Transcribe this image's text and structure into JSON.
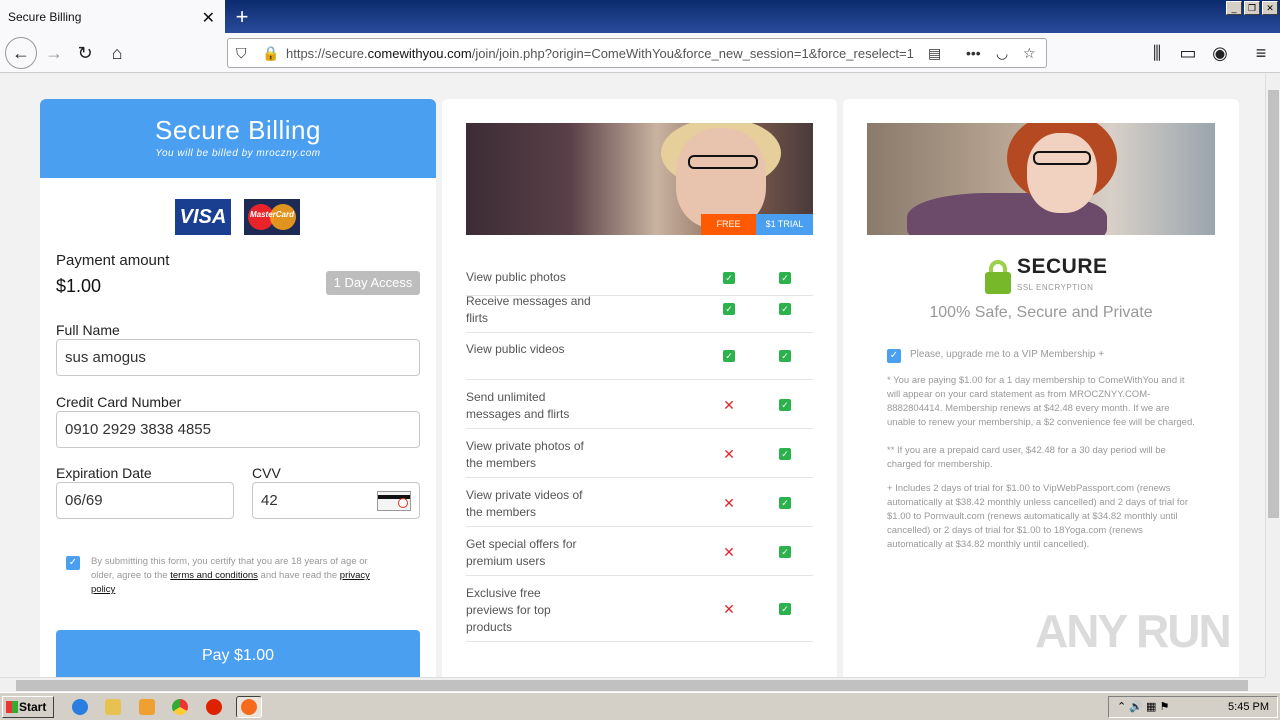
{
  "browser": {
    "tab_title": "Secure Billing",
    "url_prefix": "https://secure.",
    "url_domain": "comewithyou.com",
    "url_rest": "/join/join.php?origin=ComeWithYou&force_new_session=1&force_reselect=1"
  },
  "billing": {
    "title": "Secure Billing",
    "subtitle": "You will be billed by mroczny.com",
    "visa": "VISA",
    "mastercard": "MasterCard",
    "payment_label": "Payment amount",
    "amount": "$1.00",
    "access": "1 Day Access",
    "full_name_label": "Full Name",
    "full_name": "sus amogus",
    "cc_label": "Credit Card Number",
    "cc": "0910 2929 3838 4855",
    "exp_label": "Expiration Date",
    "exp": "06/69",
    "cvv_label": "CVV",
    "cvv": "42",
    "terms_pre": "By submitting this form, you certify that you are 18 years of age or older, agree to the ",
    "terms_link": "terms and conditions",
    "terms_mid": " and have read the ",
    "privacy_link": "privacy policy",
    "pay": "Pay $1.00"
  },
  "compare": {
    "free": "FREE",
    "trial": "$1 TRIAL",
    "features": [
      {
        "label": "View public photos",
        "free": true,
        "trial": true
      },
      {
        "label": "Receive messages and flirts",
        "free": true,
        "trial": true
      },
      {
        "label": "View public videos",
        "free": true,
        "trial": true
      },
      {
        "label": "Send unlimited messages and flirts",
        "free": false,
        "trial": true
      },
      {
        "label": "View private photos of the members",
        "free": false,
        "trial": true
      },
      {
        "label": "View private videos of the members",
        "free": false,
        "trial": true
      },
      {
        "label": "Get special offers for premium users",
        "free": false,
        "trial": true
      },
      {
        "label": "Exclusive free previews for top products",
        "free": false,
        "trial": true
      }
    ]
  },
  "security": {
    "secure": "SECURE",
    "ssl": "SSL ENCRYPTION",
    "safe": "100% Safe, Secure and Private",
    "vip": "Please, upgrade me to a VIP Membership +",
    "note1": "* You are paying $1.00 for a 1 day membership to ComeWithYou and it will appear on your card statement as from MROCZNYY.COM-8882804414. Membership renews at $42.48 every month. If we are unable to renew your membership, a $2 convenience fee will be charged.",
    "note2": "** If you are a prepaid card user, $42.48 for a 30 day period will be charged for membership.",
    "note3": "+ Includes 2 days of trial for $1.00 to VipWebPassport.com (renews automatically at $38.42 monthly unless cancelled) and 2 days of trial for $1.00 to Pornvault.com (renews automatically at $34.82 monthly until cancelled) or 2 days of trial for $1.00 to 18Yoga.com (renews automatically at $34.82 monthly until cancelled)."
  },
  "watermark": "ANY RUN",
  "taskbar": {
    "start": "Start",
    "time": "5:45 PM"
  }
}
